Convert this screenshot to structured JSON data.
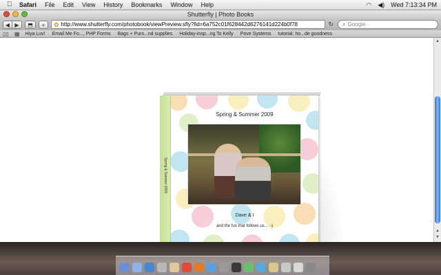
{
  "menubar": {
    "apple": "",
    "app_name": "Safari",
    "items": [
      "File",
      "Edit",
      "View",
      "History",
      "Bookmarks",
      "Window",
      "Help"
    ],
    "clock": "Wed 7:13:34 PM"
  },
  "window": {
    "title": "Shutterfly | Photo Books",
    "url": "http://www.shutterfly.com/photobook/viewPreview.sfly?fid=6a752c01f628442d6276141d224b0f78",
    "search_placeholder": "Google",
    "bookmarks": [
      "Hiya Luv!",
      "Email Me Fo..., PHP Forms",
      "Bags + Purs...nd supplies",
      "Holiday-insp...ng To Kelly",
      "Pove Systems",
      "tutorial: ho...de goodness"
    ]
  },
  "book": {
    "title": "Spring & Summer 2009",
    "spine_text": "Spring & Summer 2009",
    "caption_line1": "Dave & I",
    "caption_line2": "and the fun that follows us... :-)",
    "spine_color": "#c6de97"
  },
  "icons": {
    "back": "◀",
    "forward": "▶",
    "add": "+",
    "reload": "↻",
    "search": "🔍",
    "bookmarks_book": "📖",
    "grid": "▦"
  }
}
